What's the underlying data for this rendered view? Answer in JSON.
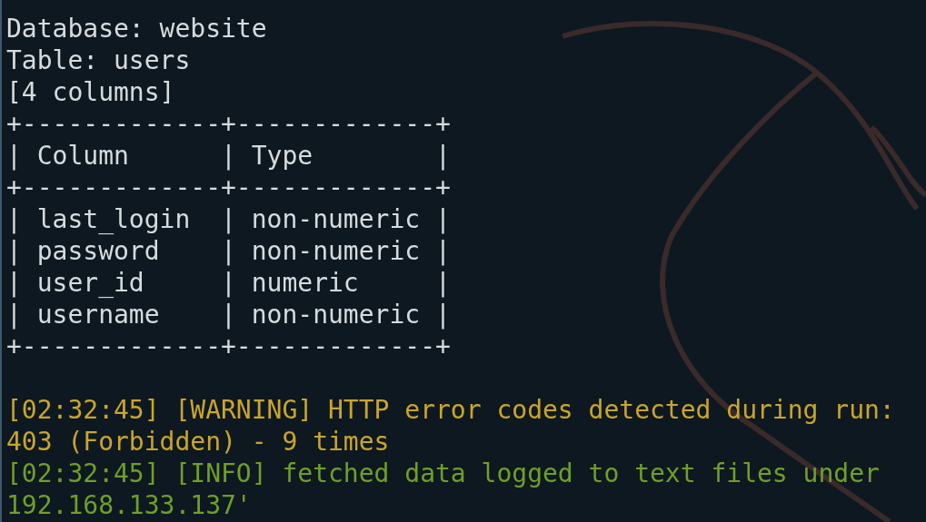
{
  "terminal": {
    "lines": [
      {
        "kind": "output",
        "text": "Database: website"
      },
      {
        "kind": "output",
        "text": "Table: users"
      },
      {
        "kind": "output",
        "text": "[4 columns]"
      },
      {
        "kind": "output",
        "text": "+-------------+-------------+"
      },
      {
        "kind": "output",
        "text": "| Column      | Type        |"
      },
      {
        "kind": "output",
        "text": "+-------------+-------------+"
      },
      {
        "kind": "output",
        "text": "| last_login  | non-numeric |"
      },
      {
        "kind": "output",
        "text": "| password    | non-numeric |"
      },
      {
        "kind": "output",
        "text": "| user_id     | numeric     |"
      },
      {
        "kind": "output",
        "text": "| username    | non-numeric |"
      },
      {
        "kind": "output",
        "text": "+-------------+-------------+"
      },
      {
        "kind": "blank"
      },
      {
        "kind": "warning",
        "text": "[02:32:45] [WARNING] HTTP error codes detected during run:"
      },
      {
        "kind": "warning",
        "text": "403 (Forbidden) - 9 times"
      },
      {
        "kind": "info",
        "text": "[02:32:45] [INFO] fetched data logged to text files under"
      },
      {
        "kind": "info",
        "text": "192.168.133.137'"
      }
    ]
  }
}
